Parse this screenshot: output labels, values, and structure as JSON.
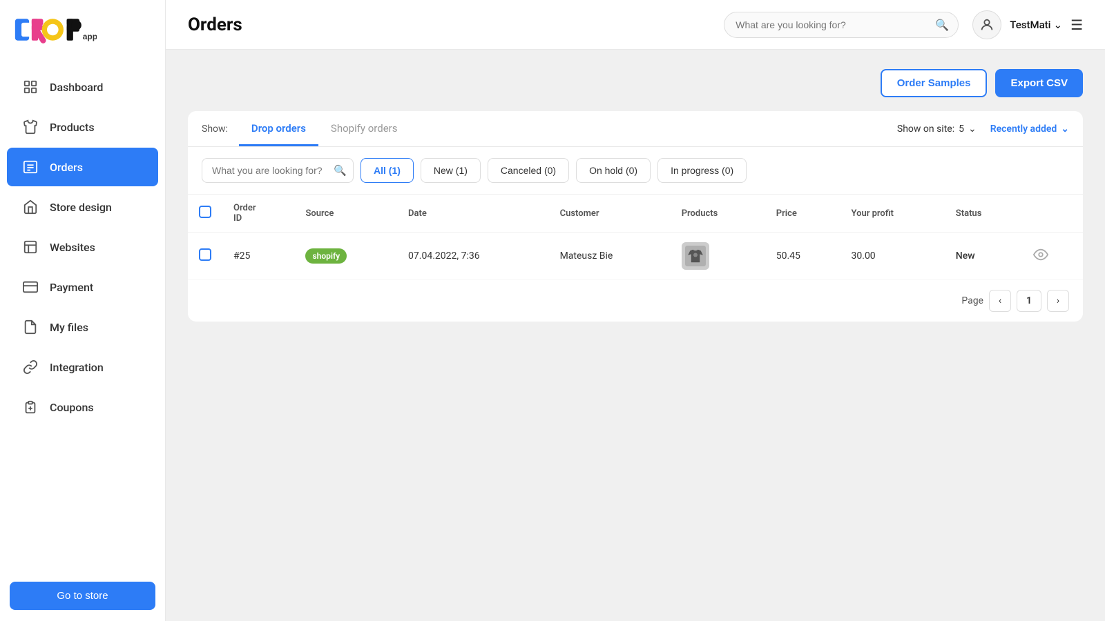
{
  "app": {
    "name": "DROPapp"
  },
  "sidebar": {
    "items": [
      {
        "id": "dashboard",
        "label": "Dashboard",
        "icon": "dashboard"
      },
      {
        "id": "products",
        "label": "Products",
        "icon": "products"
      },
      {
        "id": "orders",
        "label": "Orders",
        "icon": "orders",
        "active": true
      },
      {
        "id": "store-design",
        "label": "Store design",
        "icon": "store-design"
      },
      {
        "id": "websites",
        "label": "Websites",
        "icon": "websites"
      },
      {
        "id": "payment",
        "label": "Payment",
        "icon": "payment"
      },
      {
        "id": "my-files",
        "label": "My files",
        "icon": "my-files"
      },
      {
        "id": "integration",
        "label": "Integration",
        "icon": "integration"
      },
      {
        "id": "coupons",
        "label": "Coupons",
        "icon": "coupons"
      }
    ],
    "go_to_store": "Go to store"
  },
  "header": {
    "title": "Orders",
    "search_placeholder": "What are you looking for?",
    "user": {
      "name": "TestMati"
    }
  },
  "actions": {
    "order_samples": "Order Samples",
    "export_csv": "Export CSV"
  },
  "tabs": {
    "show_label": "Show:",
    "drop_orders": "Drop orders",
    "shopify_orders": "Shopify orders",
    "show_on_site_label": "Show on site:",
    "show_on_site_value": "5",
    "recently_added": "Recently added"
  },
  "filters": {
    "search_placeholder": "What you are looking for?",
    "buttons": [
      {
        "label": "All (1)",
        "active": true
      },
      {
        "label": "New (1)",
        "active": false
      },
      {
        "label": "Canceled (0)",
        "active": false
      },
      {
        "label": "On hold (0)",
        "active": false
      },
      {
        "label": "In progress (0)",
        "active": false
      }
    ]
  },
  "table": {
    "columns": [
      {
        "key": "order_id",
        "label": "Order ID"
      },
      {
        "key": "source",
        "label": "Source"
      },
      {
        "key": "date",
        "label": "Date"
      },
      {
        "key": "customer",
        "label": "Customer"
      },
      {
        "key": "products",
        "label": "Products"
      },
      {
        "key": "price",
        "label": "Price"
      },
      {
        "key": "your_profit",
        "label": "Your profit"
      },
      {
        "key": "status",
        "label": "Status"
      }
    ],
    "rows": [
      {
        "order_id": "#25",
        "source": "shopify",
        "date": "07.04.2022, 7:36",
        "customer": "Mateusz Bie",
        "price": "50.45",
        "your_profit": "30.00",
        "status": "New"
      }
    ]
  },
  "pagination": {
    "page_label": "Page",
    "current_page": "1"
  }
}
